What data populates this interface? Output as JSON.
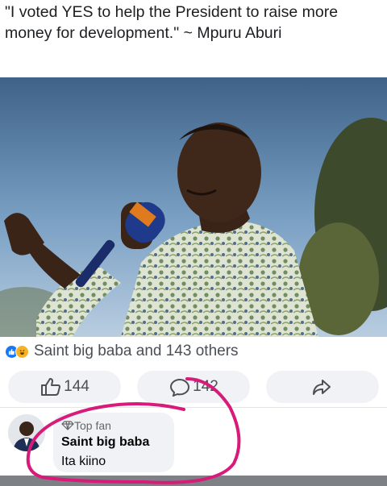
{
  "post": {
    "caption": "\"I voted YES to help the President to raise more money for development.\" ~ Mpuru Aburi"
  },
  "reactions": {
    "icons": [
      "like-icon",
      "haha-icon"
    ],
    "summary": "Saint big baba and 143 others"
  },
  "actions": {
    "like_count": "144",
    "comment_count": "142",
    "share_icon": "share-arrow-icon"
  },
  "comment": {
    "badge": "Top fan",
    "badge_icon": "diamond-icon",
    "author": "Saint big baba",
    "text": "Ita kiino"
  },
  "colors": {
    "facebook_blue": "#1877f2",
    "annotation_circle": "#d81b7a",
    "haha_yellow": "#f7b125"
  }
}
